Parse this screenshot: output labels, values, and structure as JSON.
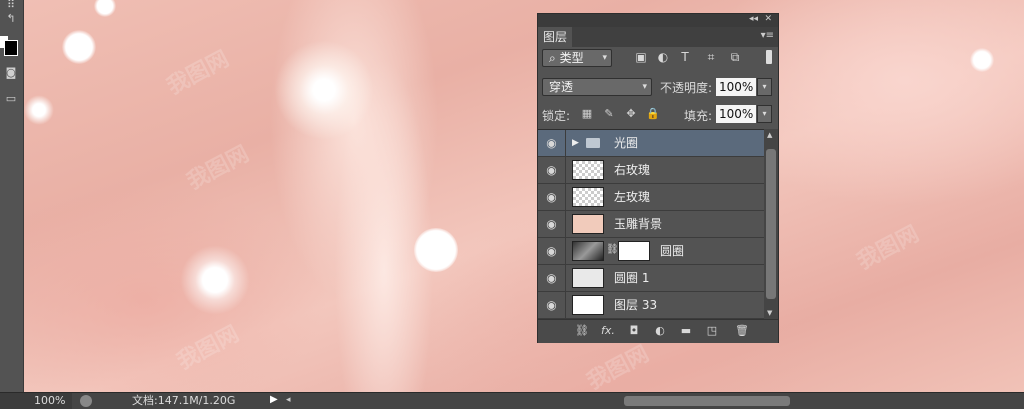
{
  "status": {
    "zoom": "100%",
    "doc": "文档:147.1M/1.20G"
  },
  "watermark": "我图网",
  "panel": {
    "tab": "图层",
    "filter_kind": "类型",
    "blend_mode": "穿透",
    "opacity_label": "不透明度:",
    "opacity_value": "100%",
    "lock_label": "锁定:",
    "fill_label": "填充:",
    "fill_value": "100%",
    "layers": [
      {
        "name": "光圈",
        "kind": "group"
      },
      {
        "name": "右玫瑰",
        "kind": "layer"
      },
      {
        "name": "左玫瑰",
        "kind": "layer"
      },
      {
        "name": "玉雕背景",
        "kind": "layer"
      },
      {
        "name": "圆圈",
        "kind": "masked"
      },
      {
        "name": "圆圈 1",
        "kind": "layer"
      },
      {
        "name": "图层 33",
        "kind": "layer"
      }
    ]
  },
  "glyphs": {
    "collapse": "◂◂",
    "close": "✕",
    "menu": "▾≡",
    "search": "⌕",
    "dropdown": "▾",
    "eye": "◉",
    "triangle": "▶",
    "link": "⛓",
    "fx": "fx.",
    "mask": "◘",
    "adjust": "◐",
    "folder": "▬",
    "new": "◳",
    "trash": "🗑",
    "play": "▶",
    "left": "◂",
    "filter_image": "▣",
    "filter_adjust": "◐",
    "filter_text": "T",
    "filter_shape": "⌗",
    "filter_smart": "⧉",
    "lock_pixels": "▦",
    "lock_brush": "✎",
    "lock_move": "✥",
    "lock_all": "🔒"
  },
  "colors": {
    "selected_row": "#5b6a7c",
    "panel_bg": "#535353"
  }
}
